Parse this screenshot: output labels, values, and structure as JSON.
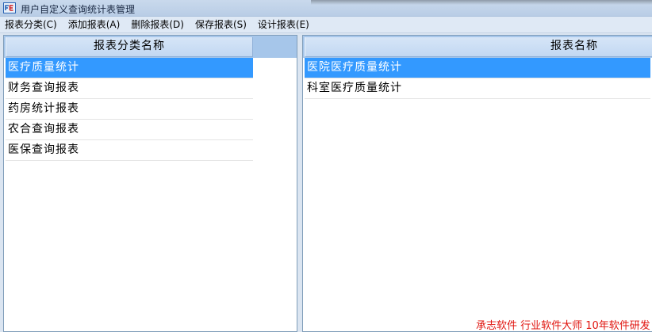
{
  "window": {
    "title": "用户自定义查询统计表管理"
  },
  "menu": {
    "items": [
      {
        "label": "报表分类(C)"
      },
      {
        "label": "添加报表(A)"
      },
      {
        "label": "删除报表(D)"
      },
      {
        "label": "保存报表(S)"
      },
      {
        "label": "设计报表(E)"
      }
    ]
  },
  "left_panel": {
    "header": "报表分类名称",
    "rows": [
      {
        "label": "医疗质量统计",
        "selected": true
      },
      {
        "label": "财务查询报表",
        "selected": false
      },
      {
        "label": "药房统计报表",
        "selected": false
      },
      {
        "label": "农合查询报表",
        "selected": false
      },
      {
        "label": "医保查询报表",
        "selected": false
      }
    ]
  },
  "right_panel": {
    "header": "报表名称",
    "rows": [
      {
        "label": "医院医疗质量统计",
        "selected": true
      },
      {
        "label": "科室医疗质量统计",
        "selected": false
      }
    ]
  },
  "footer": {
    "text": "承志软件 行业软件大师 10年软件研发"
  },
  "colors": {
    "selection": "#3399ff",
    "header": "#c2d8f2",
    "footer_text": "#e0140e"
  },
  "icons": {
    "app": "app-icon"
  }
}
